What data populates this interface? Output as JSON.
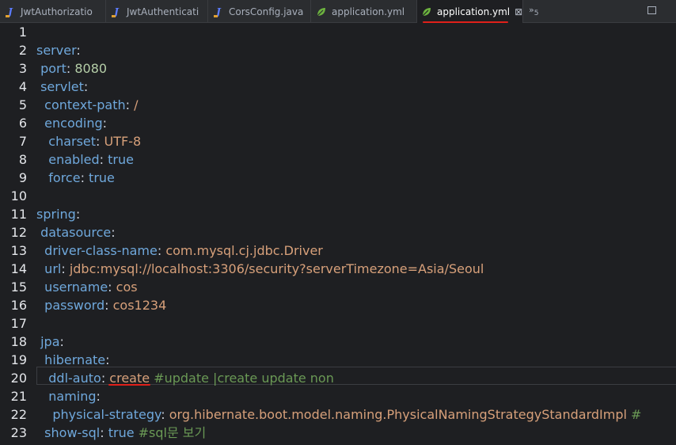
{
  "tabs": [
    {
      "label": "JwtAuthorizatio",
      "icon": "java-class-icon",
      "active": false
    },
    {
      "label": "JwtAuthenticati",
      "icon": "java-class-icon",
      "active": false
    },
    {
      "label": "CorsConfig.java",
      "icon": "java-class-icon",
      "active": false
    },
    {
      "label": "application.yml",
      "icon": "spring-leaf-icon",
      "active": false
    },
    {
      "label": "application.yml",
      "icon": "spring-leaf-icon",
      "active": true
    }
  ],
  "overflow_count": "5",
  "colors": {
    "key": "#6fa8dc",
    "number": "#b5cea8",
    "string": "#d7a07a",
    "comment": "#6a9955",
    "annotation_underline": "#e0201a"
  },
  "editor": {
    "lines": [
      {
        "num": "1",
        "indent": "",
        "key": "",
        "sep": "",
        "val": "",
        "valType": "",
        "comment": ""
      },
      {
        "num": "2",
        "indent": "",
        "key": "server",
        "sep": ":",
        "val": "",
        "valType": "",
        "comment": ""
      },
      {
        "num": "3",
        "indent": " ",
        "key": "port",
        "sep": ": ",
        "val": "8080",
        "valType": "n",
        "comment": ""
      },
      {
        "num": "4",
        "indent": " ",
        "key": "servlet",
        "sep": ":",
        "val": "",
        "valType": "",
        "comment": ""
      },
      {
        "num": "5",
        "indent": "  ",
        "key": "context-path",
        "sep": ": ",
        "val": "/",
        "valType": "s",
        "comment": ""
      },
      {
        "num": "6",
        "indent": "  ",
        "key": "encoding",
        "sep": ":",
        "val": "",
        "valType": "",
        "comment": ""
      },
      {
        "num": "7",
        "indent": "   ",
        "key": "charset",
        "sep": ": ",
        "val": "UTF-8",
        "valType": "s",
        "comment": ""
      },
      {
        "num": "8",
        "indent": "   ",
        "key": "enabled",
        "sep": ": ",
        "val": "true",
        "valType": "k",
        "comment": ""
      },
      {
        "num": "9",
        "indent": "   ",
        "key": "force",
        "sep": ": ",
        "val": "true",
        "valType": "k",
        "comment": ""
      },
      {
        "num": "10",
        "indent": "",
        "key": "",
        "sep": "",
        "val": "",
        "valType": "",
        "comment": ""
      },
      {
        "num": "11",
        "indent": "",
        "key": "spring",
        "sep": ":",
        "val": "",
        "valType": "",
        "comment": ""
      },
      {
        "num": "12",
        "indent": " ",
        "key": "datasource",
        "sep": ":",
        "val": "",
        "valType": "",
        "comment": ""
      },
      {
        "num": "13",
        "indent": "  ",
        "key": "driver-class-name",
        "sep": ": ",
        "val": "com.mysql.cj.jdbc.Driver",
        "valType": "s",
        "comment": ""
      },
      {
        "num": "14",
        "indent": "  ",
        "key": "url",
        "sep": ": ",
        "val": "jdbc:mysql://localhost:3306/security?serverTimezone=Asia/Seoul",
        "valType": "s",
        "comment": ""
      },
      {
        "num": "15",
        "indent": "  ",
        "key": "username",
        "sep": ": ",
        "val": "cos",
        "valType": "s",
        "comment": ""
      },
      {
        "num": "16",
        "indent": "  ",
        "key": "password",
        "sep": ": ",
        "val": "cos1234",
        "valType": "s",
        "comment": ""
      },
      {
        "num": "17",
        "indent": "",
        "key": "",
        "sep": "",
        "val": "",
        "valType": "",
        "comment": ""
      },
      {
        "num": "18",
        "indent": " ",
        "key": "jpa",
        "sep": ":",
        "val": "",
        "valType": "",
        "comment": ""
      },
      {
        "num": "19",
        "indent": "  ",
        "key": "hibernate",
        "sep": ":",
        "val": "",
        "valType": "",
        "comment": ""
      },
      {
        "num": "20",
        "indent": "   ",
        "key": "ddl-auto",
        "sep": ": ",
        "val": "create",
        "valType": "s",
        "comment": " #update |create update non"
      },
      {
        "num": "21",
        "indent": "   ",
        "key": "naming",
        "sep": ":",
        "val": "",
        "valType": "",
        "comment": ""
      },
      {
        "num": "22",
        "indent": "    ",
        "key": "physical-strategy",
        "sep": ": ",
        "val": "org.hibernate.boot.model.naming.PhysicalNamingStrategyStandardImpl",
        "valType": "s",
        "comment": " #"
      },
      {
        "num": "23",
        "indent": "  ",
        "key": "show-sql",
        "sep": ": ",
        "val": "true",
        "valType": "k",
        "comment": " #sql문 보기"
      }
    ]
  }
}
